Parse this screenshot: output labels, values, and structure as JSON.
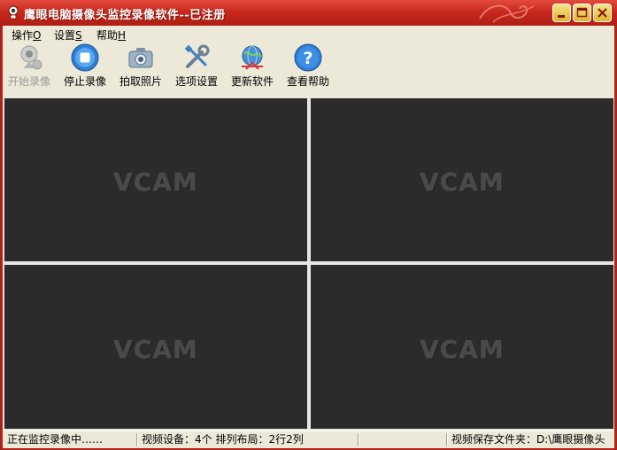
{
  "window": {
    "title": "鹰眼电脑摄像头监控录像软件--已注册"
  },
  "menu": {
    "items": [
      {
        "label": "操作",
        "accel": "O"
      },
      {
        "label": "设置",
        "accel": "S"
      },
      {
        "label": "帮助",
        "accel": "H"
      }
    ]
  },
  "toolbar": {
    "items": [
      {
        "label": "开始录像",
        "icon": "webcam-icon",
        "enabled": false
      },
      {
        "label": "停止录像",
        "icon": "stop-icon",
        "enabled": true
      },
      {
        "label": "拍取照片",
        "icon": "camera-icon",
        "enabled": true
      },
      {
        "label": "选项设置",
        "icon": "tools-icon",
        "enabled": true
      },
      {
        "label": "更新软件",
        "icon": "globe-update-icon",
        "enabled": true
      },
      {
        "label": "查看帮助",
        "icon": "help-icon",
        "enabled": true
      }
    ]
  },
  "video": {
    "panes": [
      {
        "watermark": "VCAM"
      },
      {
        "watermark": "VCAM"
      },
      {
        "watermark": "VCAM"
      },
      {
        "watermark": "VCAM"
      }
    ]
  },
  "status": {
    "state": "正在监控录像中……",
    "devices": "视频设备：4个 排列布局：2行2列",
    "empty": "",
    "save_folder": "视频保存文件夹：D:\\鹰眼摄像头"
  },
  "colors": {
    "titlebar": "#c8281d",
    "pane_background": "#2b2b2b",
    "chrome": "#ece9d8"
  }
}
